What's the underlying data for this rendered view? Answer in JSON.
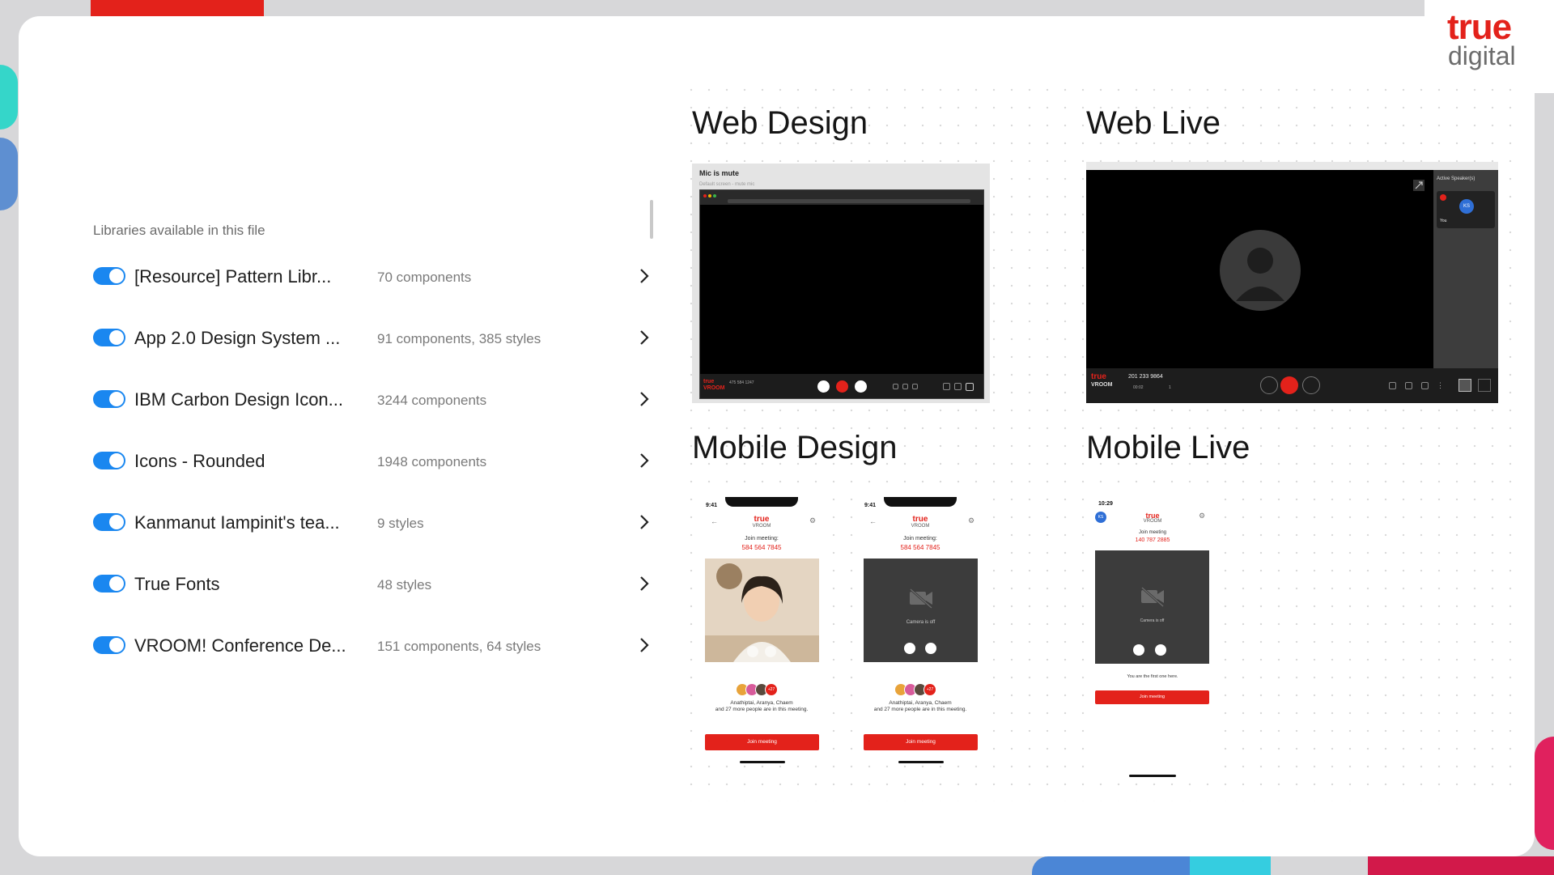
{
  "brand": {
    "line1": "true",
    "line2": "digital",
    "primary_color": "#e3221b"
  },
  "libraries": {
    "heading": "Libraries available in this file",
    "items": [
      {
        "name": "[Resource] Pattern Libr...",
        "meta": "70 components",
        "enabled": true
      },
      {
        "name": "App 2.0 Design System ...",
        "meta": "91 components, 385 styles",
        "enabled": true
      },
      {
        "name": "IBM Carbon Design Icon...",
        "meta": "3244 components",
        "enabled": true
      },
      {
        "name": "Icons - Rounded",
        "meta": "1948 components",
        "enabled": true
      },
      {
        "name": "Kanmanut Iampinit's tea...",
        "meta": "9 styles",
        "enabled": true
      },
      {
        "name": "True Fonts",
        "meta": "48 styles",
        "enabled": true
      },
      {
        "name": "VROOM! Conference De...",
        "meta": "151 components, 64 styles",
        "enabled": true
      }
    ]
  },
  "sections": {
    "web_design": {
      "title": "Web Design",
      "header": "Mic is mute",
      "subheader": "Default screen - mute mic",
      "meeting_id": "475 584 1247",
      "brand": "true VROOM"
    },
    "web_live": {
      "title": "Web Live",
      "meeting_id": "201 233 9864",
      "timer": "00:02",
      "participants": "1",
      "brand_line1": "true",
      "brand_line2": "VROOM",
      "side_title": "Active Speaker(s)",
      "side_initials": "KS",
      "side_label": "You"
    },
    "mobile_design": {
      "title": "Mobile Design",
      "phones": [
        {
          "time": "9:41",
          "brand": "true",
          "brand2": "VROOM",
          "join_label": "Join meeting:",
          "code": "584 564 7845",
          "camera": "on",
          "extra_count": "+27",
          "names": "Anathiptai, Aranya, Chaem",
          "names2": "and 27 more people are in this meeting.",
          "button": "Join meeting"
        },
        {
          "time": "9:41",
          "brand": "true",
          "brand2": "VROOM",
          "join_label": "Join meeting:",
          "code": "584 564 7845",
          "camera": "off",
          "camera_off_text": "Camera is off",
          "extra_count": "+27",
          "names": "Anathiptai, Aranya, Chaem",
          "names2": "and 27 more people are in this meeting.",
          "button": "Join meeting"
        }
      ]
    },
    "mobile_live": {
      "title": "Mobile Live",
      "time": "10:29",
      "initials": "KS",
      "brand": "true",
      "brand2": "VROOM",
      "join_label": "Join meeting",
      "code": "140 787 2885",
      "camera_off_text": "Camera is off",
      "first_one": "You are the first one here.",
      "button": "Join meeting"
    }
  }
}
